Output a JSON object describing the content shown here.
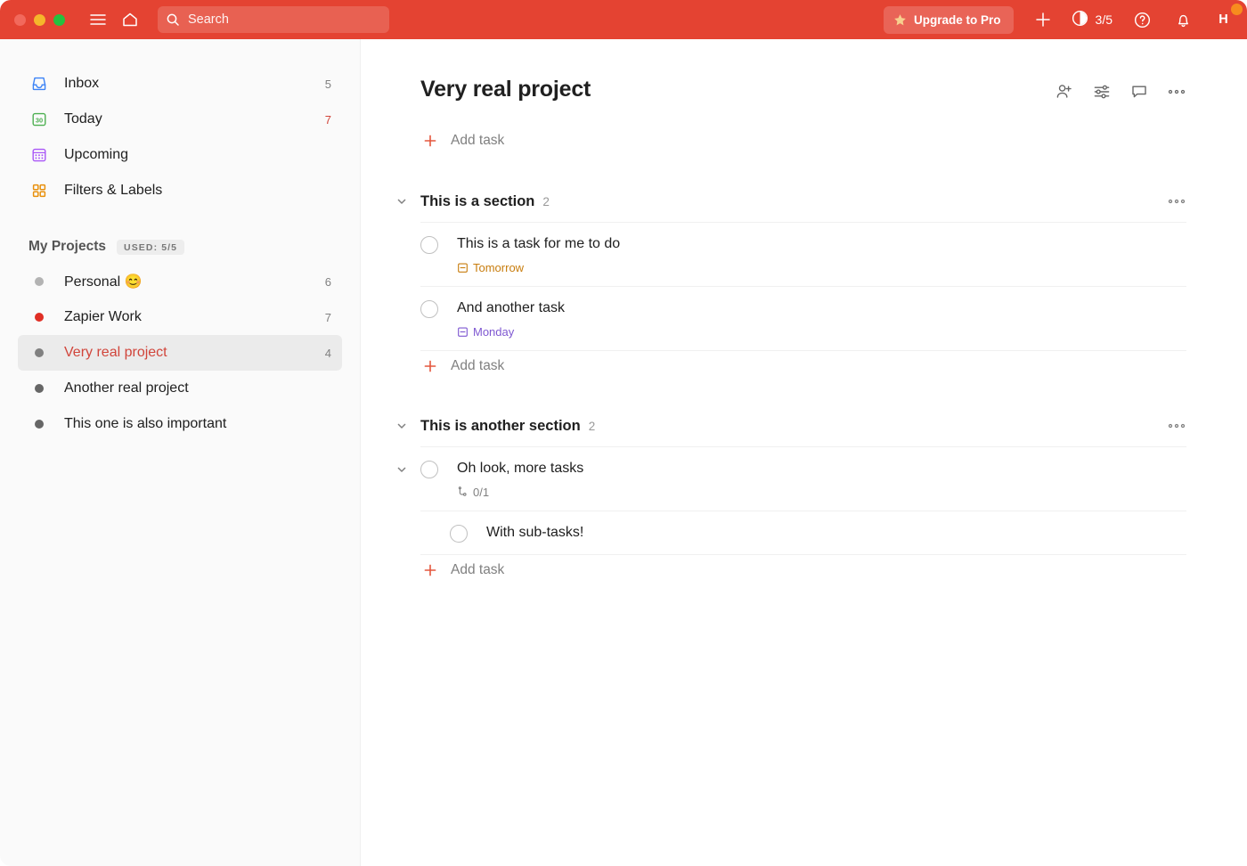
{
  "titlebar": {
    "window_controls": [
      "close",
      "minimize",
      "zoom"
    ],
    "menu_icon": "hamburger-icon",
    "home_icon": "home-icon",
    "search": {
      "icon": "search-icon",
      "placeholder": "Search"
    },
    "upgrade_label": "Upgrade to Pro",
    "upgrade_icon": "star-icon",
    "add_icon": "plus-icon",
    "karma": {
      "icon": "productivity-icon",
      "value": "3/5"
    },
    "help_icon": "question-mark-icon",
    "notifications_icon": "bell-icon",
    "avatar_initial": "H",
    "accent_color": "#e44332",
    "notification_dot_color": "#f78c1e"
  },
  "sidebar": {
    "nav": [
      {
        "label": "Inbox",
        "icon": "inbox-icon",
        "count": "5",
        "count_accent": false
      },
      {
        "label": "Today",
        "icon": "today-icon",
        "count": "7",
        "count_accent": true
      },
      {
        "label": "Upcoming",
        "icon": "upcoming-icon",
        "count": "",
        "count_accent": false
      },
      {
        "label": "Filters & Labels",
        "icon": "filters-icon",
        "count": "",
        "count_accent": false
      }
    ],
    "projects_header": {
      "label": "My Projects",
      "badge": "USED: 5/5"
    },
    "projects": [
      {
        "label": "Personal 😊",
        "count": "6",
        "color": "#b3b3b3",
        "selected": false
      },
      {
        "label": "Zapier Work",
        "count": "7",
        "color": "#e02f25",
        "selected": false
      },
      {
        "label": "Very real project",
        "count": "4",
        "color": "#808080",
        "selected": true
      },
      {
        "label": "Another real project",
        "count": "",
        "color": "#666666",
        "selected": false
      },
      {
        "label": "This one is also important",
        "count": "",
        "color": "#666666",
        "selected": false
      }
    ]
  },
  "main": {
    "title": "Very real project",
    "actions": [
      {
        "icon": "add-person-icon"
      },
      {
        "icon": "view-options-icon"
      },
      {
        "icon": "comments-icon"
      },
      {
        "icon": "more-options-icon"
      }
    ],
    "add_task_top": "Add task",
    "sections": [
      {
        "name": "This is a section",
        "count": "2",
        "menu_icon": "more-options-icon",
        "tasks": [
          {
            "title": "This is a task for me to do",
            "due": "Tomorrow",
            "due_style": "due-orange",
            "due_icon": "calendar-icon",
            "has_chevron": false,
            "subtask": false
          },
          {
            "title": "And another task",
            "due": "Monday",
            "due_style": "due-purple",
            "due_icon": "calendar-icon",
            "has_chevron": false,
            "subtask": false
          }
        ],
        "add_task": "Add task"
      },
      {
        "name": "This is another section",
        "count": "2",
        "menu_icon": "more-options-icon",
        "tasks": [
          {
            "title": "Oh look, more tasks",
            "due": "0/1",
            "due_style": "subcount",
            "due_icon": "subtask-icon",
            "has_chevron": true,
            "subtask": false
          },
          {
            "title": "With sub-tasks!",
            "due": "",
            "due_style": "",
            "due_icon": "",
            "has_chevron": false,
            "subtask": true
          }
        ],
        "add_task": "Add task"
      }
    ]
  }
}
